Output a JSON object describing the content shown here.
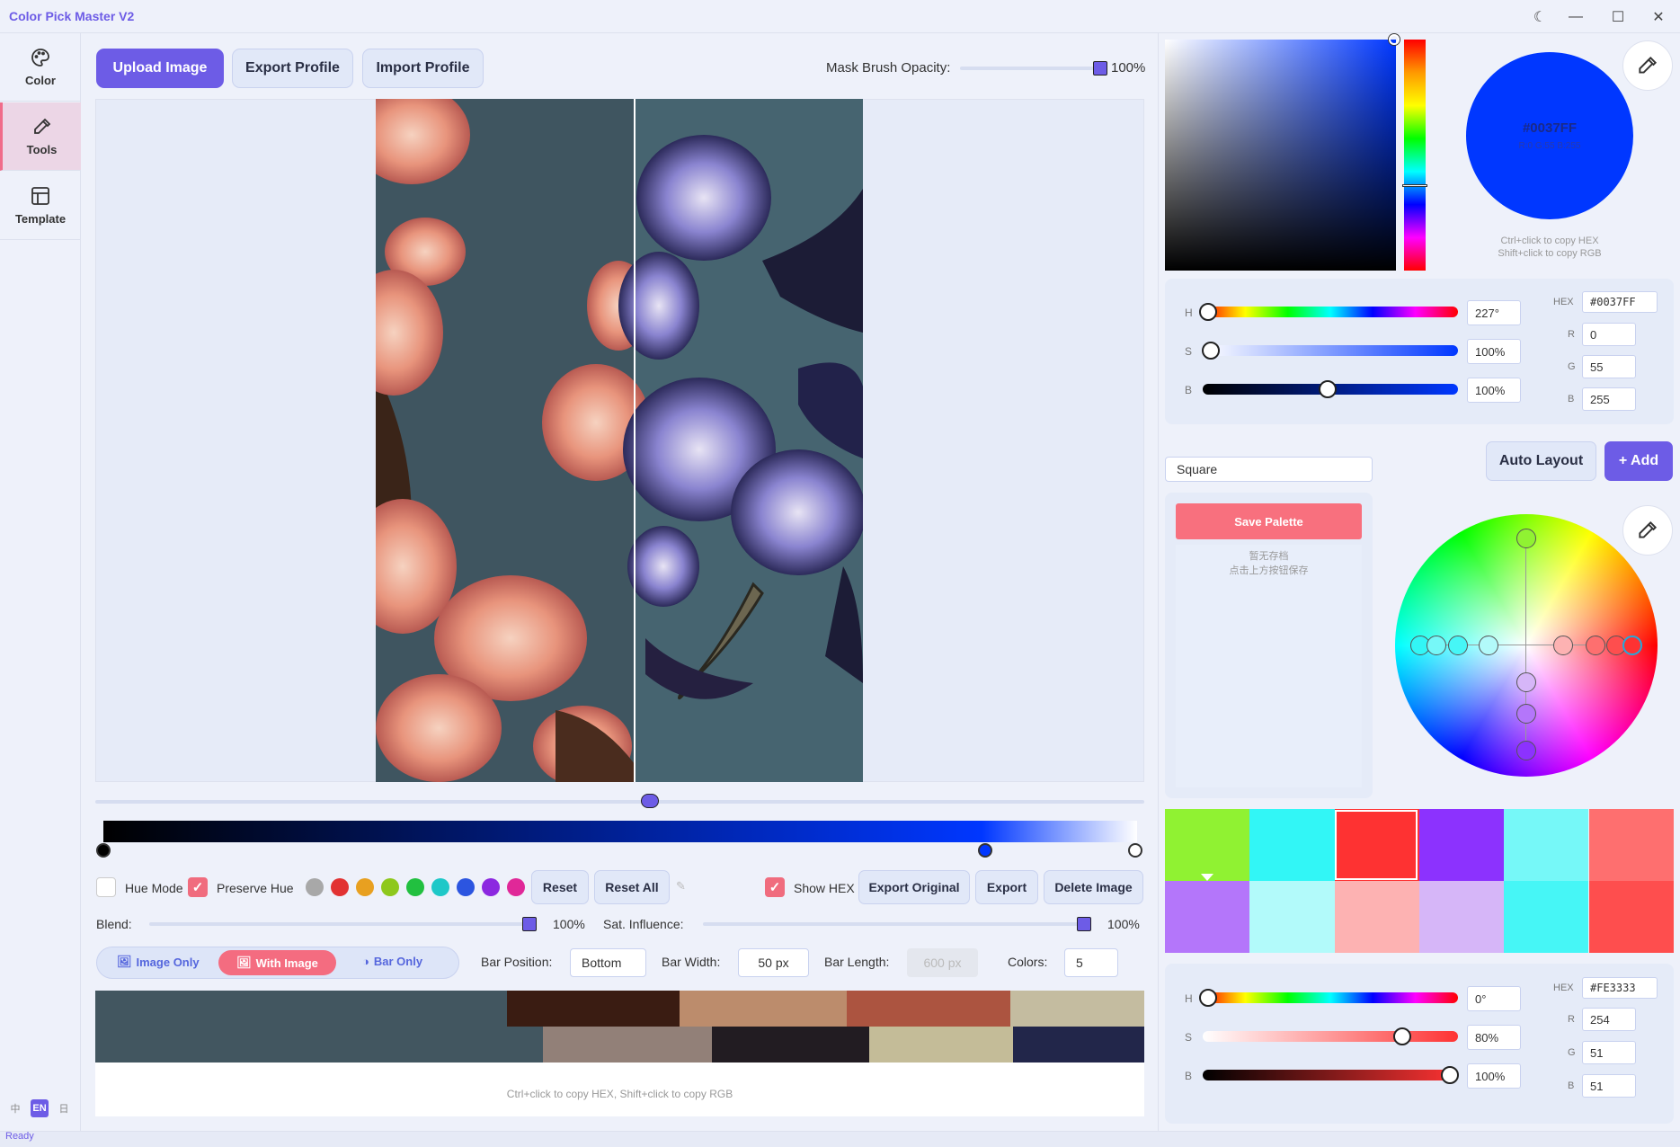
{
  "app": {
    "title": "Color Pick Master V2",
    "status": "Ready"
  },
  "nav": [
    {
      "label": "Color",
      "icon": "palette-icon",
      "active": false
    },
    {
      "label": "Tools",
      "icon": "dropper-icon",
      "active": true
    },
    {
      "label": "Template",
      "icon": "layout-icon",
      "active": false
    }
  ],
  "lang": {
    "zh": "中",
    "en": "EN",
    "ja": "日",
    "active": "EN"
  },
  "toolbar": {
    "upload": "Upload Image",
    "export_profile": "Export Profile",
    "import_profile": "Import Profile",
    "mask_label": "Mask Brush Opacity:",
    "mask_value": "100%",
    "mask_level": 1.0
  },
  "gradient": {
    "stops": [
      "#000000",
      "#0037ff",
      "#ffffff"
    ]
  },
  "controls": {
    "hue_mode": "Hue Mode",
    "hue_mode_checked": false,
    "preserve_hue": "Preserve Hue",
    "preserve_hue_checked": true,
    "swatches": [
      "#a8a8a8",
      "#e23232",
      "#e8a020",
      "#8ec81c",
      "#22c040",
      "#1ec8c8",
      "#2c55e0",
      "#8c28e0",
      "#e02898"
    ],
    "reset": "Reset",
    "reset_all": "Reset All",
    "show_hex": "Show HEX",
    "show_hex_checked": true,
    "export_original": "Export Original",
    "export": "Export",
    "delete_image": "Delete Image"
  },
  "blend": {
    "label": "Blend:",
    "value": "100%",
    "level": 1.0
  },
  "sat_influence": {
    "label": "Sat. Influence:",
    "value": "100%",
    "level": 1.0
  },
  "view_modes": {
    "image_only": "Image Only",
    "with_image": "With Image",
    "bar_only": "Bar Only",
    "active": "with_image"
  },
  "bar": {
    "position_label": "Bar Position:",
    "position": "Bottom",
    "width_label": "Bar Width:",
    "width": "50 px",
    "length_label": "Bar Length:",
    "length": "600 px",
    "colors_label": "Colors:",
    "colors": "5"
  },
  "palette_bar": {
    "row1": [
      "#425660",
      "#3a1c12",
      "#bc8c6c",
      "#ac5440",
      "#c4bca0"
    ],
    "row2": [
      "#425660",
      "#928078",
      "#221c22",
      "#c4bc98",
      "#22264a"
    ],
    "hint": "Ctrl+click to copy HEX, Shift+click to copy RGB"
  },
  "picker": {
    "hex": "#0037FF",
    "rgb_text": "R:0 G:55 B:255",
    "hint1": "Ctrl+click to copy HEX",
    "hint2": "Shift+click to copy RGB",
    "h_label": "H",
    "h_value": "227°",
    "h_level": 0.02,
    "s_label": "S",
    "s_value": "100%",
    "s_level": 0.03,
    "b_label": "B",
    "b_value": "100%",
    "b_level": 0.49,
    "hex_label": "HEX",
    "hex_field": "#0037FF",
    "r_label": "R",
    "r": "0",
    "g_label": "G",
    "g": "55",
    "b2_label": "B",
    "b": "255"
  },
  "template": {
    "shape": "Square",
    "auto_layout": "Auto Layout",
    "add": "+ Add",
    "save_palette": "Save Palette",
    "empty1": "暂无存档",
    "empty2": "点击上方按钮保存"
  },
  "grid": {
    "row1": [
      "#90f232",
      "#32f6f6",
      "#fe3232",
      "#8c32fe",
      "#76f8f8",
      "#fe6f6f"
    ],
    "row2": [
      "#b476fa",
      "#b2fafa",
      "#fdb2b2",
      "#d6b6f8",
      "#46f6f6",
      "#fe4e4e"
    ]
  },
  "picker2": {
    "hex": "#FE3333",
    "h_label": "H",
    "h_value": "0°",
    "h_level": 0.02,
    "s_label": "S",
    "s_value": "80%",
    "s_level": 0.78,
    "b_label": "B",
    "b_value": "100%",
    "b_level": 0.97,
    "hex_label": "HEX",
    "hex_field": "#FE3333",
    "r_label": "R",
    "r": "254",
    "g_label": "G",
    "g": "51",
    "b2_label": "B",
    "b": "51"
  }
}
